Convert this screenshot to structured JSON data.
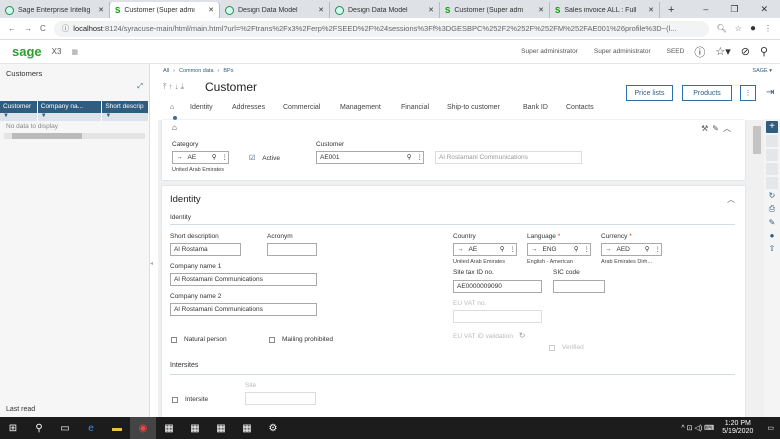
{
  "browser": {
    "tabs": [
      {
        "title": "Sage Enterprise Intellig",
        "icon": "green-circle"
      },
      {
        "title": "Customer (Super admi",
        "icon": "sage-s",
        "active": true
      },
      {
        "title": "Design Data Model",
        "icon": "green-circle"
      },
      {
        "title": "Design Data Model",
        "icon": "green-circle"
      },
      {
        "title": "Customer (Super adm",
        "icon": "sage-s"
      },
      {
        "title": "Sales invoice ALL : Full",
        "icon": "sage-s"
      }
    ],
    "url_host": "localhost",
    "url_rest": ":8124/syracuse-main/html/main.html?url=%2Ftrans%2Fx3%2Ferp%2FSEED%2F%24sessions%3Ff%3DGESBPC%252F2%252F%252FM%252FAE001%26profile%3D~(l..."
  },
  "header": {
    "logo": "sage",
    "product": "X3",
    "user1": "Super administrator",
    "user2": "Super administrator",
    "folder": "SEED"
  },
  "left_panel": {
    "title": "Customers",
    "columns": [
      "Customer",
      "Company na...",
      "Short descrip"
    ],
    "empty": "No data to display",
    "footer": "Last read"
  },
  "breadcrumb": [
    "All",
    "Common data",
    "BPs"
  ],
  "folder_menu": "SAGE",
  "page_title": "Customer",
  "buttons": {
    "price_lists": "Price lists",
    "products": "Products"
  },
  "tabs": [
    "Identity",
    "Addresses",
    "Commercial",
    "Management",
    "Financial",
    "Ship-to customer",
    "Bank ID",
    "Contacts"
  ],
  "header_card": {
    "category_label": "Category",
    "category_value": "AE",
    "category_desc": "United Arab Emirates",
    "active_label": "Active",
    "active_checked": true,
    "customer_label": "Customer",
    "customer_value": "AE001",
    "customer_name": "Al Rostamani Communications"
  },
  "identity": {
    "section_title": "Identity",
    "subsection": "Identity",
    "short_desc_label": "Short description",
    "short_desc": "Al Rostama",
    "acronym_label": "Acronym",
    "acronym": "",
    "company1_label": "Company name 1",
    "company1": "Al Rostamani Communications",
    "company2_label": "Company name 2",
    "company2": "Al Rostamani Communications",
    "natural_person": "Natural person",
    "mailing_prohibited": "Mailing prohibited",
    "country_label": "Country",
    "country": "AE",
    "country_desc": "United Arab Emirates",
    "language_label": "Language",
    "language": "ENG",
    "language_desc": "English - American",
    "currency_label": "Currency",
    "currency": "AED",
    "currency_desc": "Arab Emirates Dirh...",
    "required_mark": "*",
    "site_tax_label": "Site tax ID no.",
    "site_tax": "AE0000009090",
    "sic_label": "SIC code",
    "sic": "",
    "eu_vat_label": "EU VAT no.",
    "eu_vat_validation": "EU VAT ID validation",
    "verified": "Verified",
    "intersites_title": "Intersites",
    "intersite": "Intersite",
    "site_label": "Site"
  },
  "taskbar": {
    "time": "1:20 PM",
    "date": "5/19/2020"
  }
}
